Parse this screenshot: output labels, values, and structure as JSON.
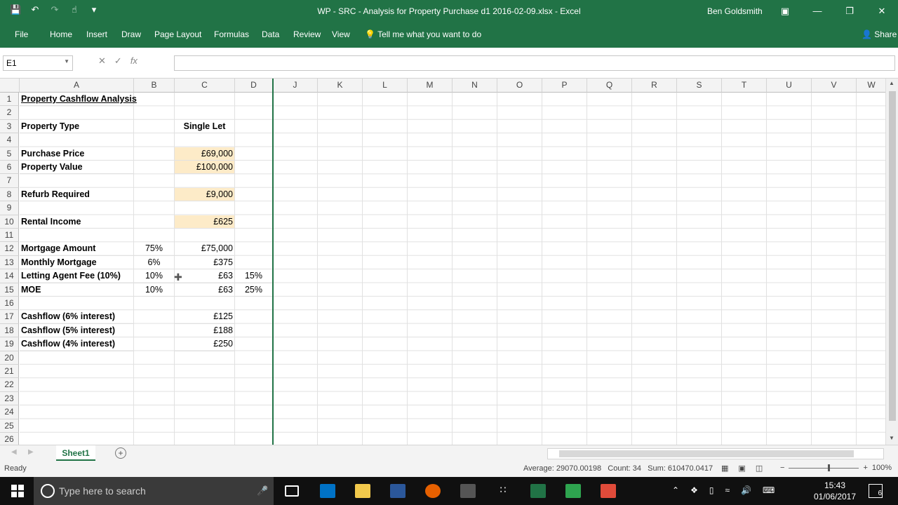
{
  "window": {
    "title": "WP - SRC - Analysis for Property Purchase d1 2016-02-09.xlsx  -  Excel",
    "user": "Ben Goldsmith"
  },
  "ribbon": {
    "tabs": [
      "File",
      "Home",
      "Insert",
      "Draw",
      "Page Layout",
      "Formulas",
      "Data",
      "Review",
      "View"
    ],
    "tell_me": "Tell me what you want to do",
    "share": "Share"
  },
  "formula_bar": {
    "name_box": "E1",
    "fx": "fx",
    "value": ""
  },
  "columns": [
    "A",
    "B",
    "C",
    "D",
    "J",
    "K",
    "L",
    "M",
    "N",
    "O",
    "P",
    "Q",
    "R",
    "S",
    "T",
    "U",
    "V",
    "W"
  ],
  "rows": [
    "1",
    "2",
    "3",
    "4",
    "5",
    "6",
    "7",
    "8",
    "9",
    "10",
    "11",
    "12",
    "13",
    "14",
    "15",
    "16",
    "17",
    "18",
    "19",
    "20",
    "21",
    "22",
    "23",
    "24",
    "25",
    "26"
  ],
  "cells": {
    "A1": "Property Cashflow Analysis",
    "A3": "Property Type",
    "C3": "Single Let",
    "A5": "Purchase Price",
    "C5": "£69,000",
    "A6": "Property Value",
    "C6": "£100,000",
    "A8": "Refurb Required",
    "C8": "£9,000",
    "A10": "Rental Income",
    "C10": "£625",
    "A12": "Mortgage Amount",
    "B12": "75%",
    "C12": "£75,000",
    "A13": "Monthly Mortgage",
    "B13": "6%",
    "C13": "£375",
    "A14": "Letting Agent Fee (10%)",
    "B14": "10%",
    "C14": "£63",
    "D14": "15%",
    "A15": "MOE",
    "B15": "10%",
    "C15": "£63",
    "D15": "25%",
    "A17": "Cashflow (6% interest)",
    "C17": "£125",
    "A18": "Cashflow (5% interest)",
    "C18": "£188",
    "A19": "Cashflow (4% interest)",
    "C19": "£250"
  },
  "sheet_tabs": {
    "active": "Sheet1",
    "add": "+"
  },
  "status": {
    "ready": "Ready",
    "average": "Average: 29070.00198",
    "count": "Count: 34",
    "sum": "Sum: 610470.0417",
    "zoom": "100%"
  },
  "taskbar": {
    "search_placeholder": "Type here to search",
    "time": "15:43",
    "date": "01/06/2017",
    "notifications": "6"
  },
  "colors": {
    "excel_green": "#217346",
    "input_fill": "#fdebc8"
  }
}
